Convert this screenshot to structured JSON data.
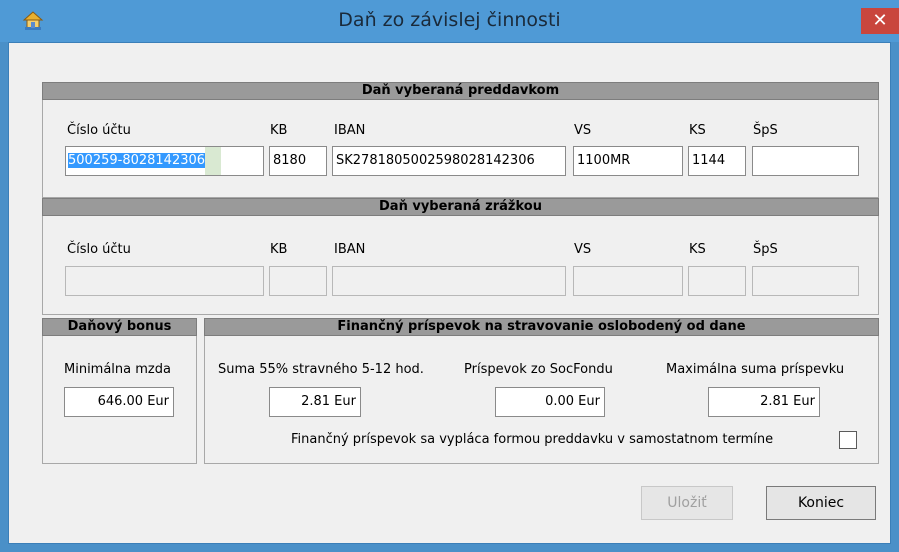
{
  "window": {
    "title": "Daň zo závislej činnosti",
    "close_label": "✕"
  },
  "advance_tax": {
    "header": "Daň vyberaná preddavkom",
    "labels": {
      "account": "Číslo účtu",
      "kb": "KB",
      "iban": "IBAN",
      "vs": "VS",
      "ks": "KS",
      "sps": "ŠpS"
    },
    "values": {
      "account": "500259-8028142306",
      "kb": "8180",
      "iban": "SK2781805002598028142306",
      "vs": "1100MR",
      "ks": "1144",
      "sps": ""
    }
  },
  "withholding_tax": {
    "header": "Daň vyberaná zrážkou",
    "labels": {
      "account": "Číslo účtu",
      "kb": "KB",
      "iban": "IBAN",
      "vs": "VS",
      "ks": "KS",
      "sps": "ŠpS"
    },
    "values": {
      "account": "",
      "kb": "",
      "iban": "",
      "vs": "",
      "ks": "",
      "sps": ""
    }
  },
  "tax_bonus": {
    "header": "Daňový bonus",
    "min_wage_label": "Minimálna mzda",
    "min_wage_value": "646.00 Eur"
  },
  "meal_contribution": {
    "header": "Finančný príspevok na stravovanie oslobodený od dane",
    "sum55_label": "Suma 55% stravného 5-12 hod.",
    "sum55_value": "2.81 Eur",
    "socfond_label": "Príspevok zo SocFondu",
    "socfond_value": "0.00 Eur",
    "max_label": "Maximálna suma príspevku",
    "max_value": "2.81 Eur",
    "advance_checkbox_label": "Finančný príspevok sa vypláca formou preddavku v samostatnom termíne",
    "advance_checkbox_checked": false
  },
  "buttons": {
    "save": "Uložiť",
    "close": "Koniec"
  }
}
